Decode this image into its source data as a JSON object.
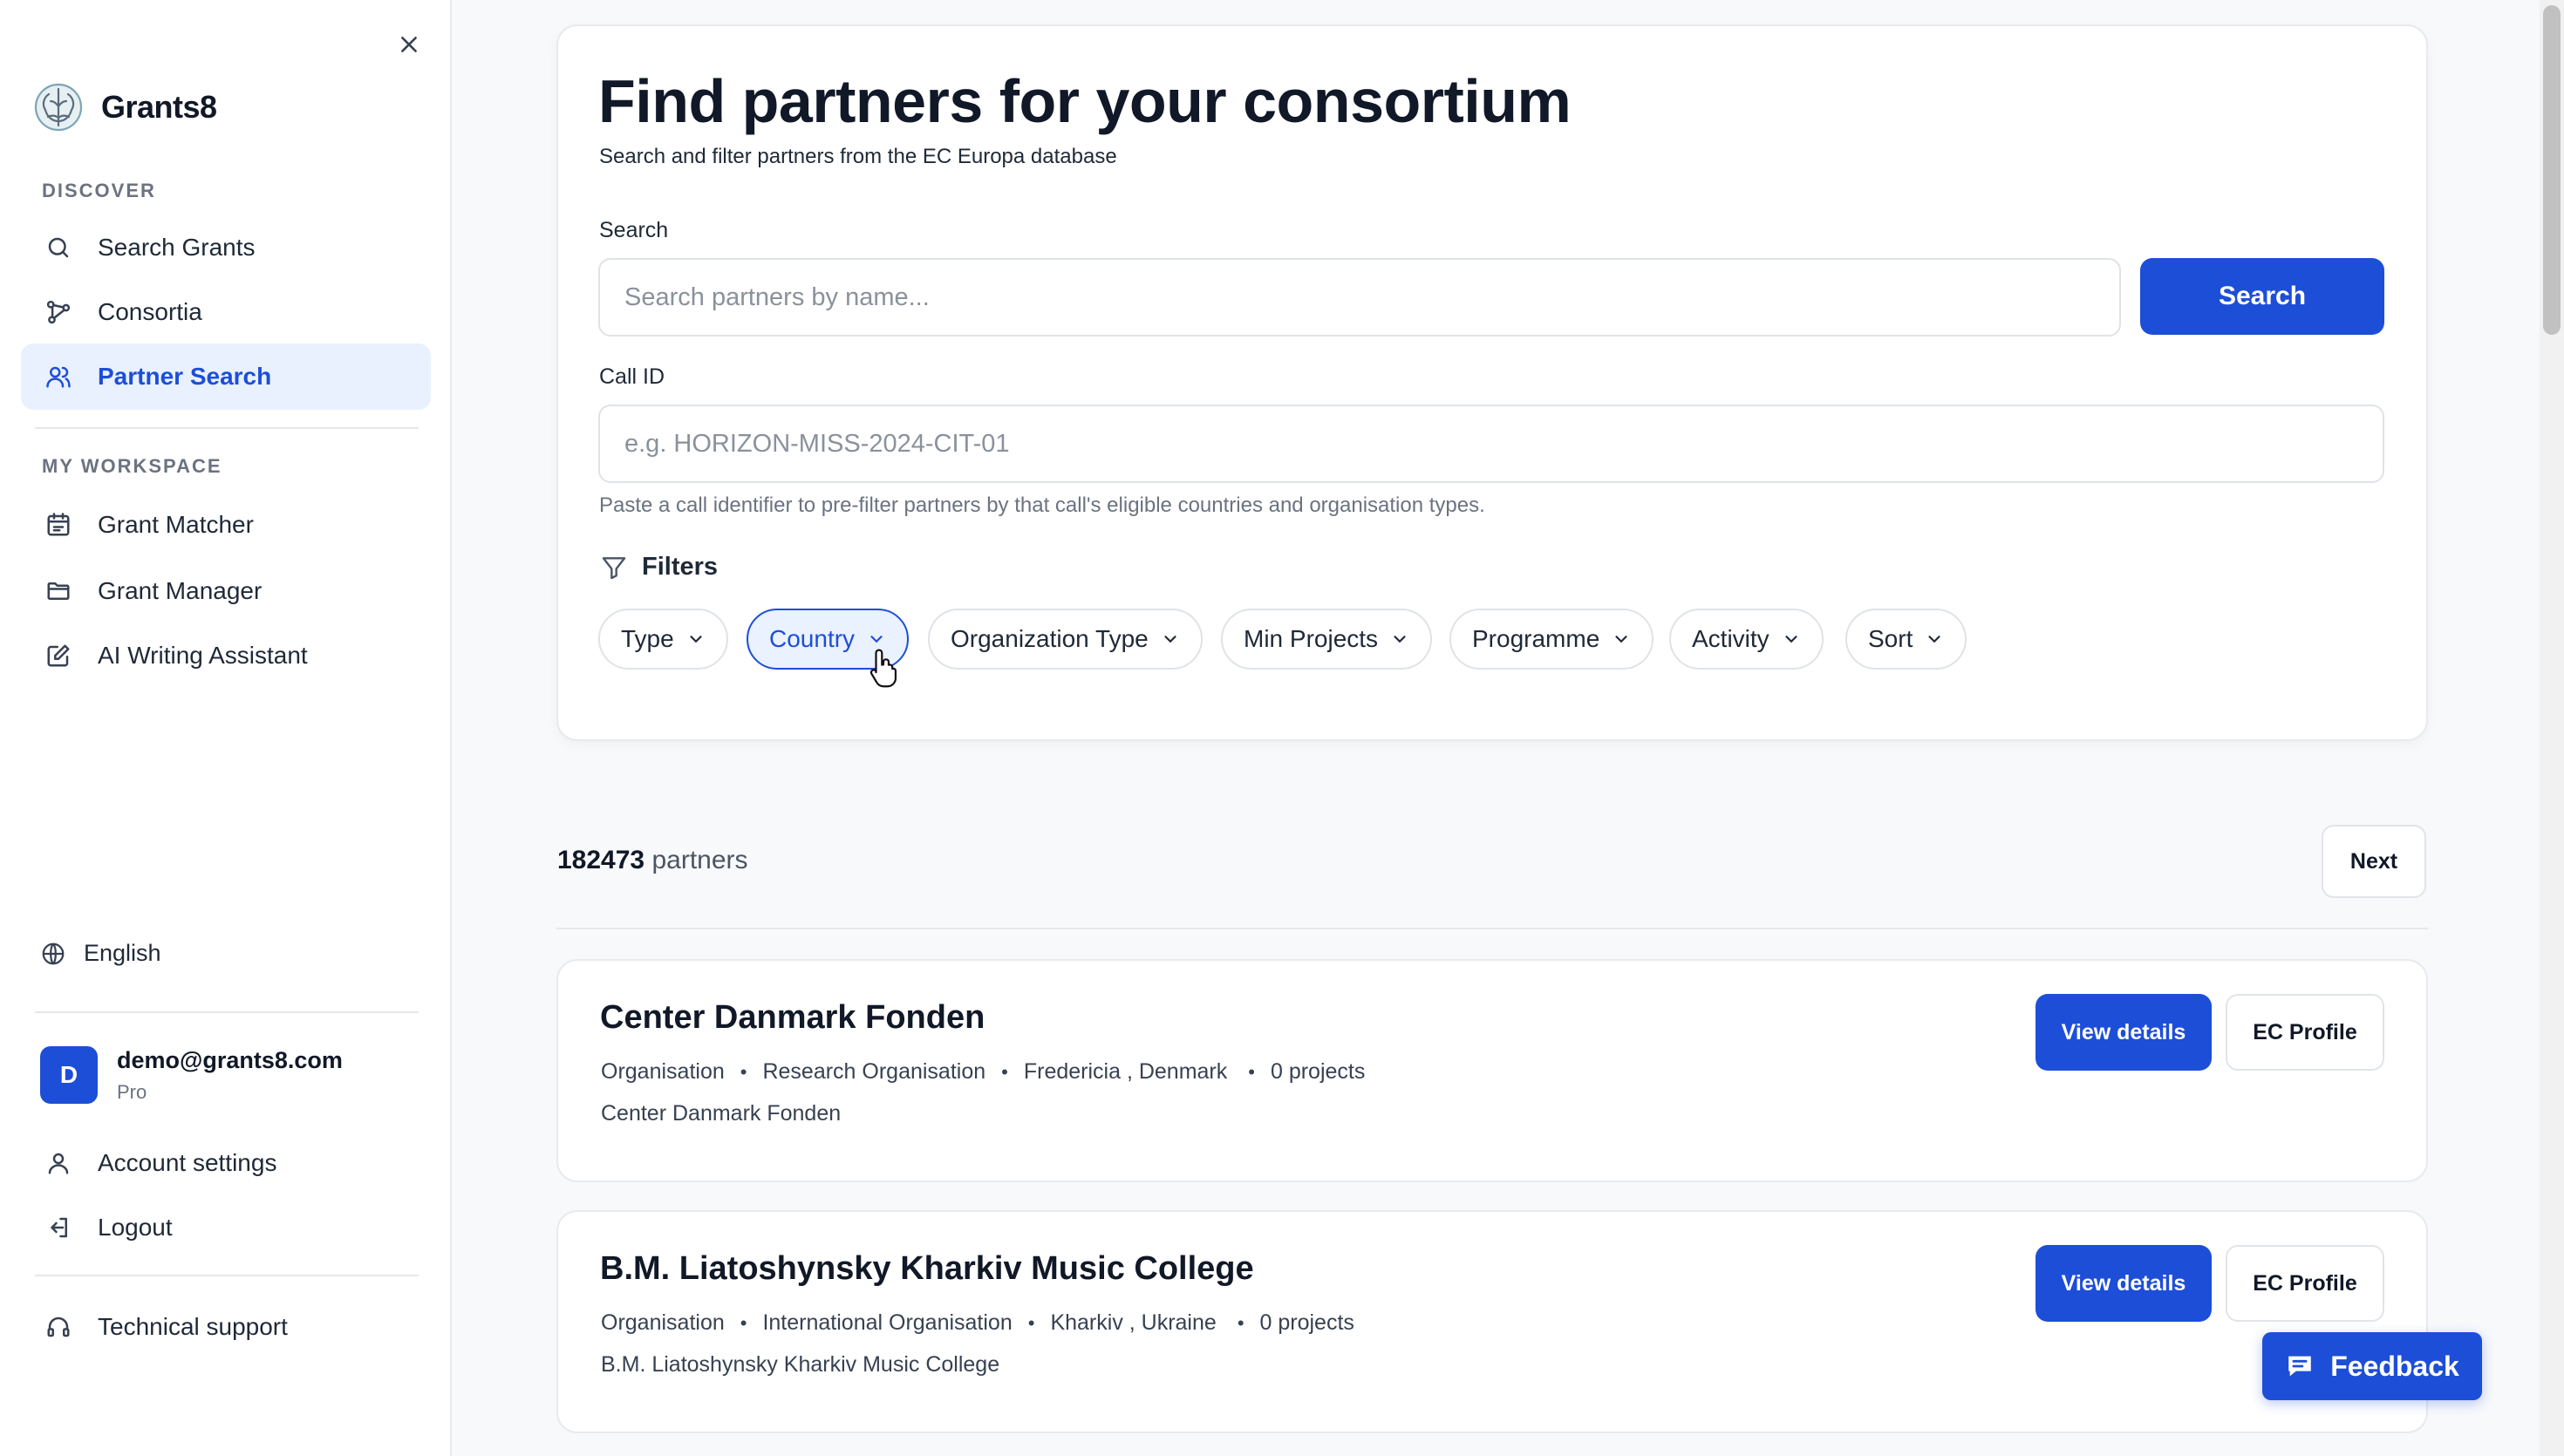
{
  "colors": {
    "accent": "#1d4ed8",
    "active_bg": "#e9f1ff",
    "text": "#111827",
    "muted": "#6b7280"
  },
  "sidebar": {
    "brand": "Grants8",
    "sections": {
      "discover": "DISCOVER",
      "workspace": "MY WORKSPACE"
    },
    "discover_items": [
      {
        "label": "Search Grants",
        "icon": "search-icon"
      },
      {
        "label": "Consortia",
        "icon": "network-icon"
      },
      {
        "label": "Partner Search",
        "icon": "users-icon",
        "active": true
      }
    ],
    "workspace_items": [
      {
        "label": "Grant Matcher",
        "icon": "calendar-check-icon"
      },
      {
        "label": "Grant Manager",
        "icon": "folder-icon"
      },
      {
        "label": "AI Writing Assistant",
        "icon": "edit-icon"
      }
    ],
    "language": "English",
    "user": {
      "initial": "D",
      "email": "demo@grants8.com",
      "plan": "Pro"
    },
    "account_settings": "Account settings",
    "logout": "Logout",
    "support": "Technical support"
  },
  "main": {
    "title": "Find partners for your consortium",
    "subtitle": "Search and filter partners from the EC Europa database",
    "search": {
      "label": "Search",
      "placeholder": "Search partners by name...",
      "value": "",
      "button": "Search"
    },
    "call_id": {
      "label": "Call ID",
      "placeholder": "e.g. HORIZON-MISS-2024-CIT-01",
      "value": "",
      "hint": "Paste a call identifier to pre-filter partners by that call's eligible countries and organisation types."
    },
    "filters_label": "Filters",
    "filters": [
      "Type",
      "Country",
      "Organization Type",
      "Min Projects",
      "Programme",
      "Activity",
      "Sort"
    ],
    "active_filter": "Country",
    "results": {
      "count": "182473",
      "suffix": "partners",
      "next": "Next"
    },
    "partners": [
      {
        "name": "Center Danmark Fonden",
        "kind": "Organisation",
        "org_type": "Research Organisation",
        "location": "Fredericia , Denmark",
        "projects": "0 projects",
        "description": "Center Danmark Fonden",
        "view": "View details",
        "profile": "EC Profile"
      },
      {
        "name": "B.M. Liatoshynsky Kharkiv Music College",
        "kind": "Organisation",
        "org_type": "International Organisation",
        "location": "Kharkiv , Ukraine",
        "projects": "0 projects",
        "description": "B.M. Liatoshynsky Kharkiv Music College",
        "view": "View details",
        "profile": "EC Profile"
      }
    ]
  },
  "feedback": "Feedback"
}
